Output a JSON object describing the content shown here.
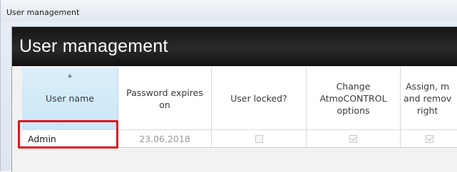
{
  "window": {
    "title": "User management"
  },
  "panel": {
    "heading": "User management"
  },
  "table": {
    "columns": [
      {
        "label": "User name",
        "sorted": true
      },
      {
        "label": "Password expires\non"
      },
      {
        "label": "User locked?"
      },
      {
        "label": "Change\nAtmoCONTROL\noptions"
      },
      {
        "label": "Assign, m\nand remov\nright"
      }
    ],
    "rows": [
      {
        "user_name": "Admin",
        "password_expires": "23.06.2018",
        "user_locked": false,
        "change_options": true,
        "assign_rights": true
      }
    ]
  },
  "colors": {
    "highlight": "#e3161b",
    "header_band": "#1e1e1e",
    "sorted_column": "#d3ebf9"
  }
}
